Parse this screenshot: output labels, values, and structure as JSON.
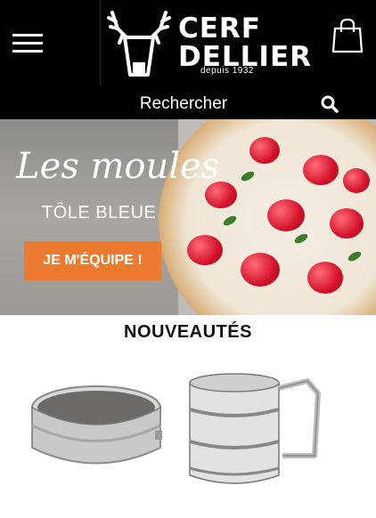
{
  "header": {
    "logo": {
      "line1": "CERF",
      "line2": "DELLIER",
      "subtitle": "depuis 1932",
      "icon": "stag-antler-glass-icon"
    },
    "menu_icon": "hamburger-menu-icon",
    "cart_icon": "shopping-bag-icon"
  },
  "search": {
    "label": "Rechercher",
    "icon": "search-icon"
  },
  "banner": {
    "title": "Les moules",
    "subtitle": "TÔLE BLEUE",
    "cta": "JE M'ÉQUIPE !",
    "accent_color": "#ec7a2f"
  },
  "new_products": {
    "title": "NOUVEAUTÉS",
    "items": [
      {
        "name": "tamis-inox",
        "image": "round-sieve"
      },
      {
        "name": "tamiseur-farine",
        "image": "flour-sifter"
      }
    ]
  }
}
